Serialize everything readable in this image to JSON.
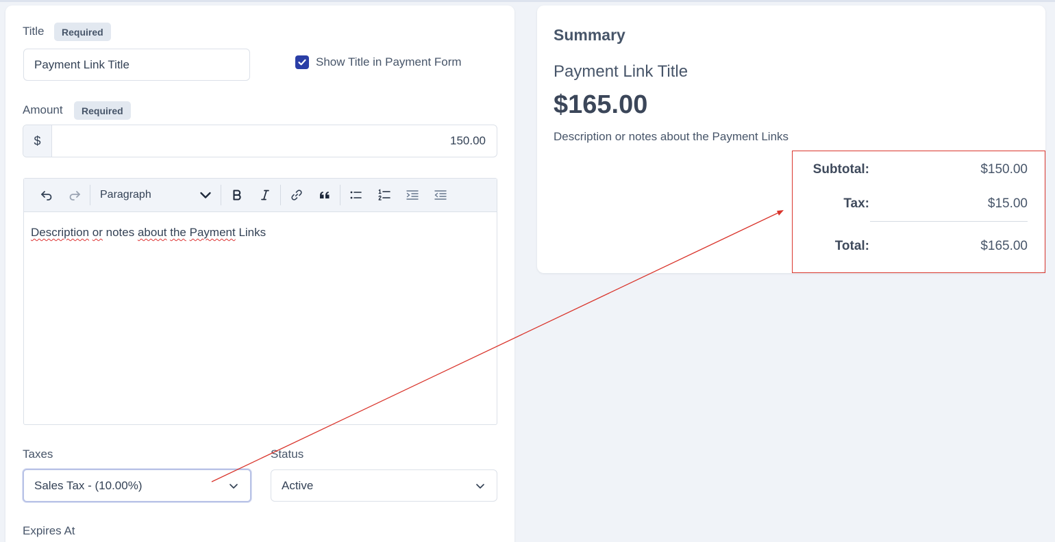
{
  "form": {
    "title_label": "Title",
    "required_badge": "Required",
    "title_value": "Payment Link Title",
    "show_title_label": "Show Title in Payment Form",
    "show_title_checked": true,
    "amount_label": "Amount",
    "currency_symbol": "$",
    "amount_value": "150.00",
    "editor": {
      "format_select": "Paragraph",
      "body_words": [
        "Description",
        "or",
        "notes",
        "about",
        "the",
        "Payment",
        "Links"
      ]
    },
    "taxes_label": "Taxes",
    "taxes_value": "Sales Tax - (10.00%)",
    "status_label": "Status",
    "status_value": "Active",
    "expires_label": "Expires At"
  },
  "summary": {
    "heading": "Summary",
    "title": "Payment Link Title",
    "amount": "$165.00",
    "description": "Description or notes about the Payment Links",
    "subtotal_label": "Subtotal:",
    "subtotal_value": "$150.00",
    "tax_label": "Tax:",
    "tax_value": "$15.00",
    "total_label": "Total:",
    "total_value": "$165.00"
  },
  "icons": {
    "checkbox": "check-icon",
    "toolbar": [
      "undo-icon",
      "redo-icon",
      "chevron-down-icon",
      "bold-icon",
      "italic-icon",
      "link-icon",
      "quote-icon",
      "bulleted-list-icon",
      "numbered-list-icon",
      "indent-icon",
      "outdent-icon"
    ],
    "select": "chevron-down-icon"
  },
  "colors": {
    "accent": "#2a3ea6",
    "page_bg": "#f0f3f8",
    "annotation": "#d9342b"
  }
}
